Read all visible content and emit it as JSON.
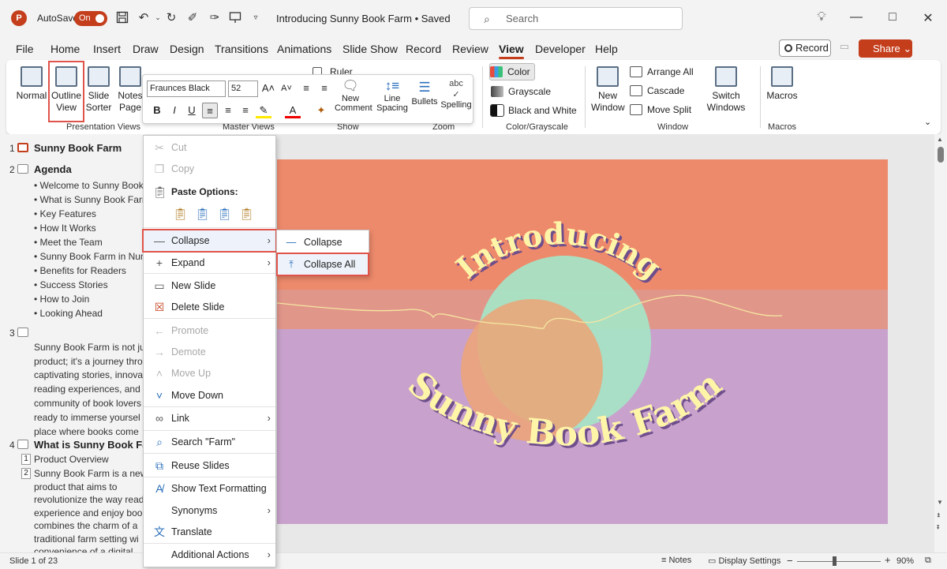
{
  "titlebar": {
    "logo": "P",
    "autosave_label": "AutoSave",
    "autosave_state": "On",
    "doc_title": "Introducing Sunny Book Farm • Saved",
    "search_placeholder": "Search"
  },
  "tabs": [
    "File",
    "Home",
    "Insert",
    "Draw",
    "Design",
    "Transitions",
    "Animations",
    "Slide Show",
    "Record",
    "Review",
    "View",
    "Developer",
    "Help"
  ],
  "active_tab": "View",
  "record_label": "Record",
  "share_label": "Share",
  "ribbon": {
    "normal": "Normal",
    "outline_view_1": "Outline",
    "outline_view_2": "View",
    "slide_sorter_1": "Slide",
    "slide_sorter_2": "Sorter",
    "notes_page_1": "Notes",
    "notes_page_2": "Page",
    "presentation_views": "Presentation Views",
    "master_views": "Master Views",
    "ruler": "Ruler",
    "show": "Show",
    "zoom": "Zoom",
    "color": "Color",
    "grayscale": "Grayscale",
    "black_and_white": "Black and White",
    "color_grayscale": "Color/Grayscale",
    "new_window_1": "New",
    "new_window_2": "Window",
    "arrange_all": "Arrange All",
    "cascade": "Cascade",
    "move_split": "Move Split",
    "window": "Window",
    "switch_windows_1": "Switch",
    "switch_windows_2": "Windows",
    "macros": "Macros",
    "macros_group": "Macros"
  },
  "minibar": {
    "font": "Fraunces Black",
    "size": "52",
    "new_comment_1": "New",
    "new_comment_2": "Comment",
    "line_spacing_1": "Line",
    "line_spacing_2": "Spacing",
    "bullets": "Bullets",
    "spelling": "Spelling"
  },
  "outline": {
    "s1_num": "1",
    "s1_title": "Sunny Book Farm",
    "s2_num": "2",
    "s2_title": "Agenda",
    "s2_items": [
      "Welcome to Sunny Book",
      "What is Sunny Book Farm",
      "Key Features",
      "How It Works",
      "Meet the Team",
      "Sunny Book Farm in Num",
      "Benefits for Readers",
      "Success Stories",
      "How to Join",
      "Looking Ahead"
    ],
    "s3_num": "3",
    "s3_lines": [
      "Sunny Book Farm is not ju",
      "product; it's a journey thro",
      "captivating stories, innova",
      "reading experiences, and",
      "community of book lovers",
      "ready to immerse yoursel",
      "place where books come"
    ],
    "s4_num": "4",
    "s4_title": "What is Sunny Book Far",
    "s4_n1": "1",
    "s4_item1": "Product Overview",
    "s4_n2": "2",
    "s4_lines": [
      "Sunny Book Farm is a new",
      "product that aims to",
      "revolutionize the way read",
      "experience and enjoy boo",
      "combines the charm of a",
      "traditional farm setting wi",
      "convenience of a digital"
    ]
  },
  "slide": {
    "headline": "Introducing",
    "subtitle": "Sunny Book Farm"
  },
  "context_menu": {
    "cut": "Cut",
    "copy": "Copy",
    "paste_options": "Paste Options:",
    "collapse": "Collapse",
    "expand": "Expand",
    "new_slide": "New Slide",
    "delete_slide": "Delete Slide",
    "promote": "Promote",
    "demote": "Demote",
    "move_up": "Move Up",
    "move_down": "Move Down",
    "link": "Link",
    "search": "Search \"Farm\"",
    "reuse_slides": "Reuse Slides",
    "show_text_formatting": "Show Text Formatting",
    "synonyms": "Synonyms",
    "translate": "Translate",
    "additional_actions": "Additional Actions"
  },
  "submenu": {
    "collapse": "Collapse",
    "collapse_all": "Collapse All"
  },
  "statusbar": {
    "slide_info": "Slide 1 of 23",
    "notes": "Notes",
    "display_settings": "Display Settings",
    "zoom_level": "90%"
  },
  "colors": {
    "accent": "#c43e1c",
    "highlight_outline": "#e0534a",
    "slide_top": "#ee8a6c",
    "slide_bottom": "#c8a2cc",
    "circle_green": "#a6e3c5",
    "circle_orange": "#eda476",
    "text_yellow": "#fff5a8",
    "text_shadow": "#6e4e8c"
  }
}
